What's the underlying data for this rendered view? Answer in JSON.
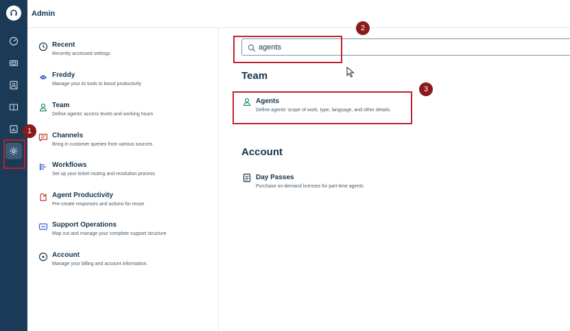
{
  "header": {
    "title": "Admin"
  },
  "rail": {
    "icons": [
      "headset-logo-icon",
      "dashboard-icon",
      "tickets-icon",
      "contacts-icon",
      "book-icon",
      "reports-icon",
      "settings-icon"
    ]
  },
  "categories": [
    {
      "title": "Recent",
      "desc": "Recently accessed settings",
      "icon": "history-icon"
    },
    {
      "title": "Freddy",
      "desc": "Manage your AI tools to boost productivity",
      "icon": "freddy-icon"
    },
    {
      "title": "Team",
      "desc": "Define agents' access levels and working hours",
      "icon": "user-icon"
    },
    {
      "title": "Channels",
      "desc": "Bring in customer queries from various sources",
      "icon": "chat-icon"
    },
    {
      "title": "Workflows",
      "desc": "Set up your ticket routing and resolution process",
      "icon": "workflow-icon"
    },
    {
      "title": "Agent Productivity",
      "desc": "Pre-create responses and actions for reuse",
      "icon": "productivity-icon"
    },
    {
      "title": "Support Operations",
      "desc": "Map out and manage your complete support structure",
      "icon": "support-ops-icon"
    },
    {
      "title": "Account",
      "desc": "Manage your billing and account information.",
      "icon": "account-icon"
    }
  ],
  "search": {
    "value": "agents",
    "placeholder": ""
  },
  "results": {
    "team_heading": "Team",
    "agents": {
      "title": "Agents",
      "desc": "Define agents' scope of work, type, language, and other details."
    },
    "account_heading": "Account",
    "day_passes": {
      "title": "Day Passes",
      "desc": "Purchase on-demand licenses for part-time agents"
    }
  },
  "annotations": {
    "one": "1",
    "two": "2",
    "three": "3"
  },
  "colors": {
    "rail": "#1b3a57",
    "highlight": "#c0202a",
    "badge": "#8b1a1a"
  }
}
